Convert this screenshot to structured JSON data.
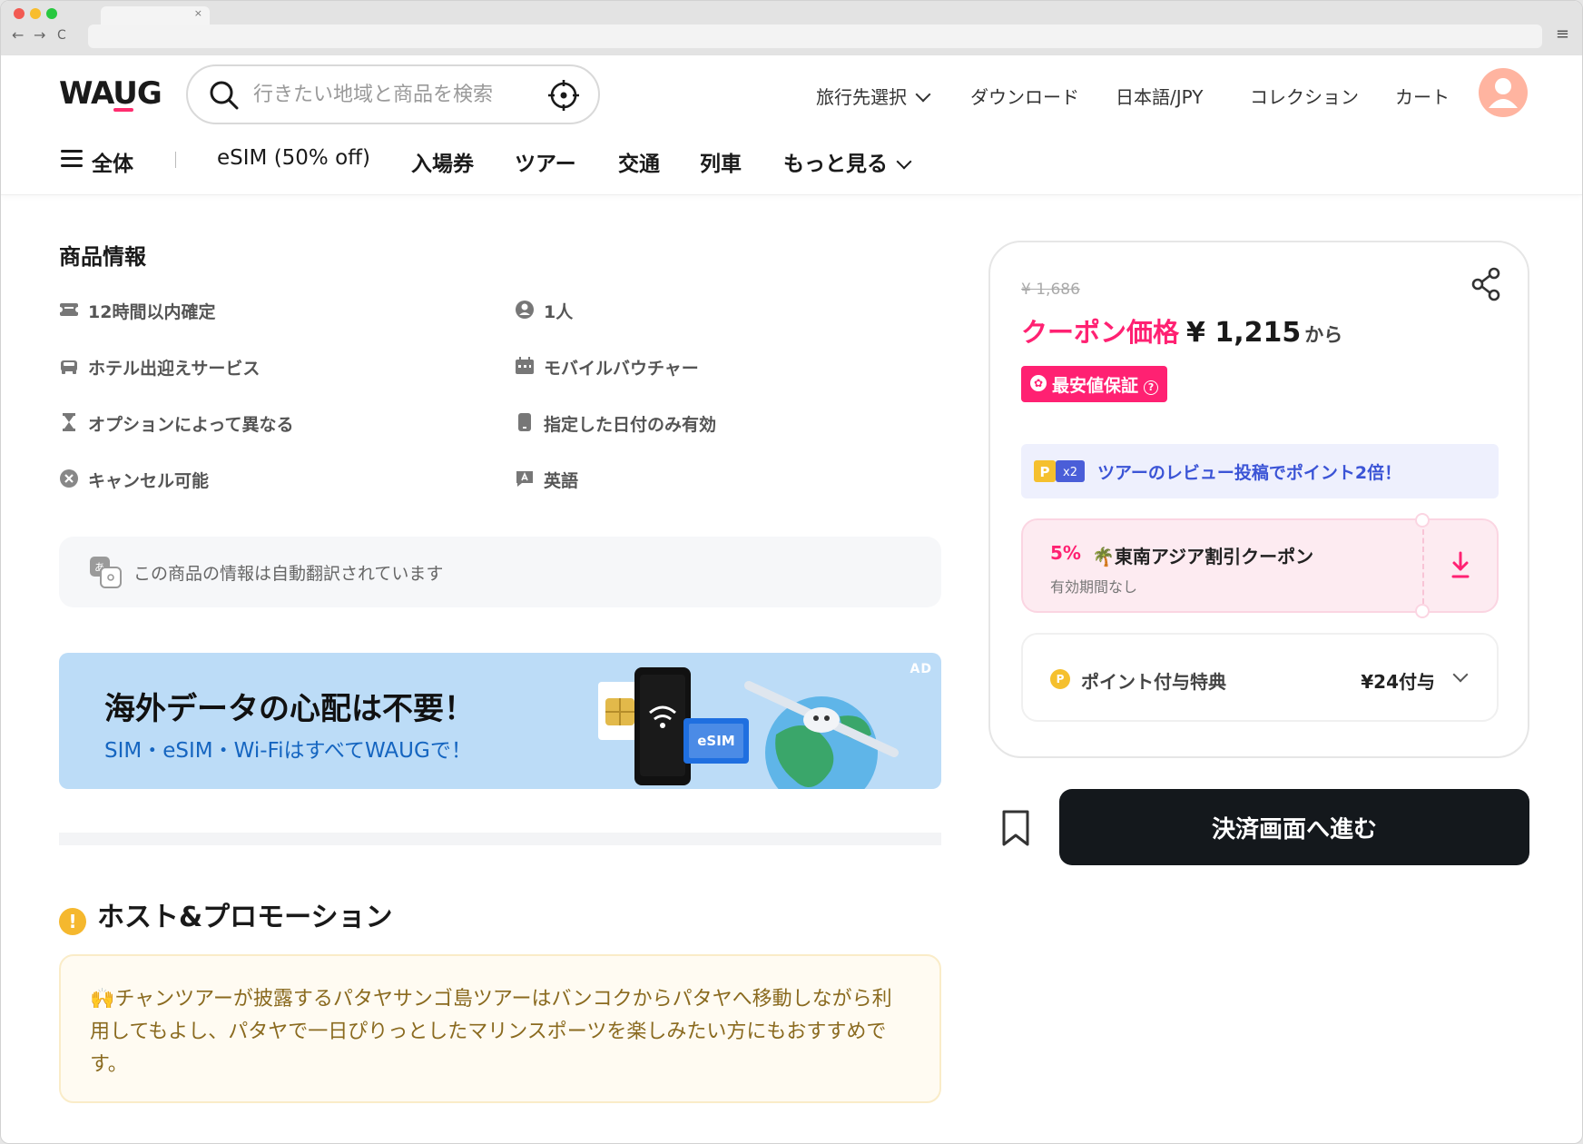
{
  "browser": {
    "tab_close": "×",
    "back": "←",
    "forward": "→",
    "reload": "C",
    "menu": "≡"
  },
  "header": {
    "logo": "WAUG",
    "search_placeholder": "行きたい地域と商品を検索",
    "nav": {
      "destination": "旅行先選択",
      "download": "ダウンロード",
      "language": "日本語/JPY",
      "collection": "コレクション",
      "cart": "カート"
    },
    "categories": {
      "all": "全体",
      "esim": "eSIM (50% off)",
      "tickets": "入場券",
      "tours": "ツアー",
      "transport": "交通",
      "train": "列車",
      "more": "もっと見る"
    }
  },
  "product_info": {
    "title": "商品情報",
    "items": [
      {
        "icon": "ticket-icon",
        "label": "12時間以内確定"
      },
      {
        "icon": "person-icon",
        "label": "1人"
      },
      {
        "icon": "car-icon",
        "label": "ホテル出迎えサービス"
      },
      {
        "icon": "calendar-icon",
        "label": "モバイルバウチャー"
      },
      {
        "icon": "hourglass-icon",
        "label": "オプションによって異なる"
      },
      {
        "icon": "phone-icon",
        "label": "指定した日付のみ有効"
      },
      {
        "icon": "cancel-circle-icon",
        "label": "キャンセル可能"
      },
      {
        "icon": "language-icon",
        "label": "英語"
      }
    ],
    "translation_notice": "この商品の情報は自動翻訳されています"
  },
  "ad": {
    "label": "AD",
    "headline": "海外データの心配は不要！",
    "subline": "SIM・eSIM・Wi-FiはすべてWAUGで！",
    "esim_label": "eSIM"
  },
  "host": {
    "title": "ホスト&プロモーション",
    "promo_text": "🙌チャンツアーが披露するパタヤサンゴ島ツアーはバンコクからパタヤへ移動しながら利用してもよし、パタヤで一日ぴりっとしたマリンスポーツを楽しみたい方にもおすすめです。"
  },
  "booking": {
    "original_price": "¥ 1,686",
    "coupon_label": "クーポン価格",
    "price": "¥ 1,215",
    "price_suffix": "から",
    "best_price_badge": "最安値保証",
    "points_banner": {
      "badge_p": "P",
      "badge_x2": "x2",
      "text": "ツアーのレビュー投稿でポイント2倍！"
    },
    "coupon": {
      "percent": "5%",
      "name": "🌴東南アジア割引クーポン",
      "validity": "有効期間なし"
    },
    "points_reward": {
      "icon_letter": "P",
      "label": "ポイント付与特典",
      "value": "¥24付与"
    },
    "checkout_label": "決済画面へ進む"
  },
  "colors": {
    "accent_pink": "#ff2172",
    "points_blue": "#3b54d6",
    "checkout_bg": "#14181c",
    "ad_bg": "#bcdcf7"
  }
}
